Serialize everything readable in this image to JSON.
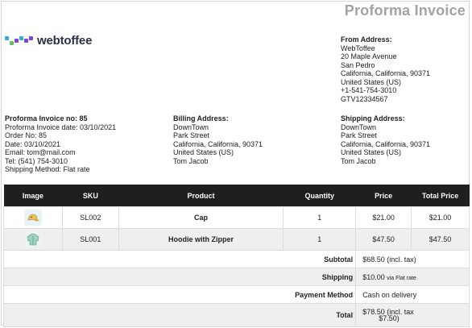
{
  "document": {
    "title": "Proforma Invoice"
  },
  "brand": {
    "name": "webtoffee",
    "colors": [
      "#3ba7e6",
      "#7a47dd",
      "#5fc45b"
    ]
  },
  "from_address": {
    "heading": "From Address:",
    "lines": [
      "WebToffee",
      "20 Maple Avenue",
      "San Pedro",
      "California, California, 90371",
      "United States (US)",
      "+1-541-754-3010",
      "GTV12334567"
    ]
  },
  "invoice_info": {
    "heading": "Proforma Invoice no: 85",
    "lines": [
      "Proforma Invoice date: 03/10/2021",
      "Order No: 85",
      "Date: 03/10/2021",
      "Email: tom@mail.com",
      "Tel: (541) 754-3010",
      "Shipping Method: Flat rate"
    ]
  },
  "billing_address": {
    "heading": "Billing Address:",
    "lines": [
      "DownTown",
      "Park Street",
      "California, California, 90371",
      "United States (US)",
      "Tom Jacob"
    ]
  },
  "shipping_address": {
    "heading": "Shipping Address:",
    "lines": [
      "DownTown",
      "Park Street",
      "California, California, 90371",
      "United States (US)",
      "Tom Jacob"
    ]
  },
  "table": {
    "columns": [
      "Image",
      "SKU",
      "Product",
      "Quantity",
      "Price",
      "Total Price"
    ],
    "rows": [
      {
        "image_icon": "cap-icon",
        "sku": "SL002",
        "product": "Cap",
        "quantity": "1",
        "price": "$21.00",
        "total": "$21.00"
      },
      {
        "image_icon": "hoodie-icon",
        "sku": "SL001",
        "product": "Hoodie with Zipper",
        "quantity": "1",
        "price": "$47.50",
        "total": "$47.50"
      }
    ]
  },
  "summary": {
    "subtotal_label": "Subtotal",
    "subtotal_value": "$68.50 (incl. tax)",
    "shipping_label": "Shipping",
    "shipping_value": "$10.00",
    "shipping_note": "via Flat rate",
    "payment_label": "Payment Method",
    "payment_value": "Cash on delivery",
    "total_label": "Total",
    "total_value": "$78.50 (incl. tax",
    "total_tax": "$7.50)"
  }
}
